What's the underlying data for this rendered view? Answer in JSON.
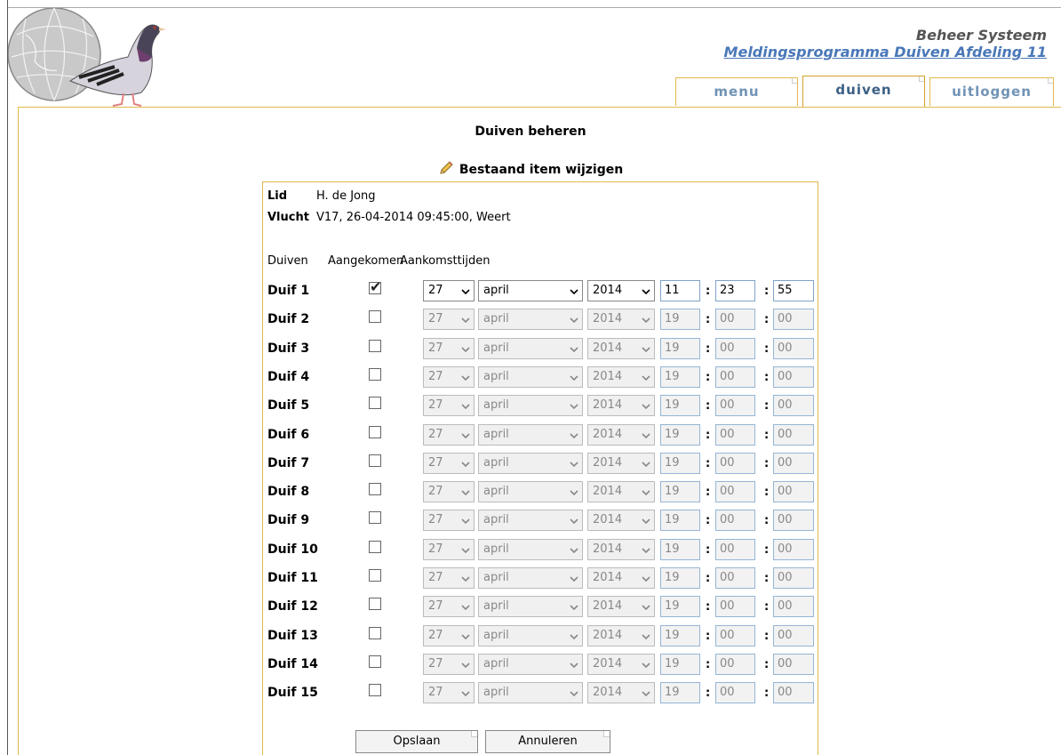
{
  "header": {
    "system_title": "Beheer Systeem",
    "program_link": "Meldingsprogramma Duiven Afdeling 11"
  },
  "tabs": [
    {
      "label": "menu",
      "active": false
    },
    {
      "label": "duiven",
      "active": true
    },
    {
      "label": "uitloggen",
      "active": false
    }
  ],
  "page": {
    "title": "Duiven beheren",
    "subtitle": "Bestaand item wijzigen"
  },
  "form": {
    "lid_label": "Lid",
    "lid_value": "H. de Jong",
    "vlucht_label": "Vlucht",
    "vlucht_value": "V17, 26-04-2014 09:45:00, Weert",
    "col_duiven": "Duiven",
    "col_aangekomen": "Aangekomen",
    "col_aankomsttijden": "Aankomsttijden",
    "rows": [
      {
        "label": "Duif 1",
        "checked": true,
        "day": "27",
        "month": "april",
        "year": "2014",
        "hour": "11",
        "minute": "23",
        "second": "55"
      },
      {
        "label": "Duif 2",
        "checked": false,
        "day": "27",
        "month": "april",
        "year": "2014",
        "hour": "19",
        "minute": "00",
        "second": "00"
      },
      {
        "label": "Duif 3",
        "checked": false,
        "day": "27",
        "month": "april",
        "year": "2014",
        "hour": "19",
        "minute": "00",
        "second": "00"
      },
      {
        "label": "Duif 4",
        "checked": false,
        "day": "27",
        "month": "april",
        "year": "2014",
        "hour": "19",
        "minute": "00",
        "second": "00"
      },
      {
        "label": "Duif 5",
        "checked": false,
        "day": "27",
        "month": "april",
        "year": "2014",
        "hour": "19",
        "minute": "00",
        "second": "00"
      },
      {
        "label": "Duif 6",
        "checked": false,
        "day": "27",
        "month": "april",
        "year": "2014",
        "hour": "19",
        "minute": "00",
        "second": "00"
      },
      {
        "label": "Duif 7",
        "checked": false,
        "day": "27",
        "month": "april",
        "year": "2014",
        "hour": "19",
        "minute": "00",
        "second": "00"
      },
      {
        "label": "Duif 8",
        "checked": false,
        "day": "27",
        "month": "april",
        "year": "2014",
        "hour": "19",
        "minute": "00",
        "second": "00"
      },
      {
        "label": "Duif 9",
        "checked": false,
        "day": "27",
        "month": "april",
        "year": "2014",
        "hour": "19",
        "minute": "00",
        "second": "00"
      },
      {
        "label": "Duif 10",
        "checked": false,
        "day": "27",
        "month": "april",
        "year": "2014",
        "hour": "19",
        "minute": "00",
        "second": "00"
      },
      {
        "label": "Duif 11",
        "checked": false,
        "day": "27",
        "month": "april",
        "year": "2014",
        "hour": "19",
        "minute": "00",
        "second": "00"
      },
      {
        "label": "Duif 12",
        "checked": false,
        "day": "27",
        "month": "april",
        "year": "2014",
        "hour": "19",
        "minute": "00",
        "second": "00"
      },
      {
        "label": "Duif 13",
        "checked": false,
        "day": "27",
        "month": "april",
        "year": "2014",
        "hour": "19",
        "minute": "00",
        "second": "00"
      },
      {
        "label": "Duif 14",
        "checked": false,
        "day": "27",
        "month": "april",
        "year": "2014",
        "hour": "19",
        "minute": "00",
        "second": "00"
      },
      {
        "label": "Duif 15",
        "checked": false,
        "day": "27",
        "month": "april",
        "year": "2014",
        "hour": "19",
        "minute": "00",
        "second": "00"
      }
    ],
    "save_button": "Opslaan",
    "cancel_button": "Annuleren"
  }
}
